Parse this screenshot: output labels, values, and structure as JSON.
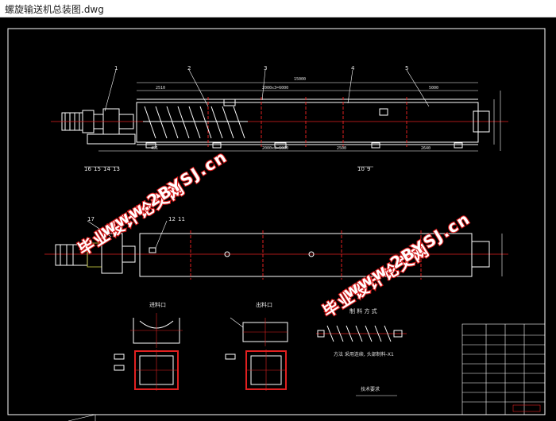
{
  "window": {
    "title": "螺旋输送机总装图.dwg"
  },
  "drawing": {
    "part_numbers": [
      "1",
      "2",
      "3",
      "4",
      "5"
    ],
    "lower_left_labels": [
      "16",
      "15",
      "14",
      "13"
    ],
    "lower_mid_labels": [
      "10",
      "9"
    ],
    "plan_labels": [
      "17",
      "12",
      "11"
    ],
    "section_titles": {
      "inlet": "进料口",
      "outlet": "出料口",
      "screw": "制 料 方 式",
      "screw_note": "方法  采用连续, 头部制料-X1",
      "tech": "技术要求"
    },
    "dims": {
      "overall": "15000",
      "d1": "2510",
      "d2": "2000x3=6000",
      "d3": "5000",
      "d4": "451",
      "d5": "2000x3=6000",
      "d6": "2500",
      "d7": "2640"
    },
    "watermark": {
      "text1": "毕业设计论文网",
      "text2": "www.2BYSJ.cn"
    }
  },
  "colors": {
    "bg": "#000000",
    "line": "#ffffff",
    "red": "#e02020",
    "cyan": "#31c0e0",
    "yellow": "#e8e048",
    "watermark_stroke": "#d61a1a"
  },
  "icons": [
    "motor-icon",
    "screw-icon",
    "title-block-icon"
  ]
}
